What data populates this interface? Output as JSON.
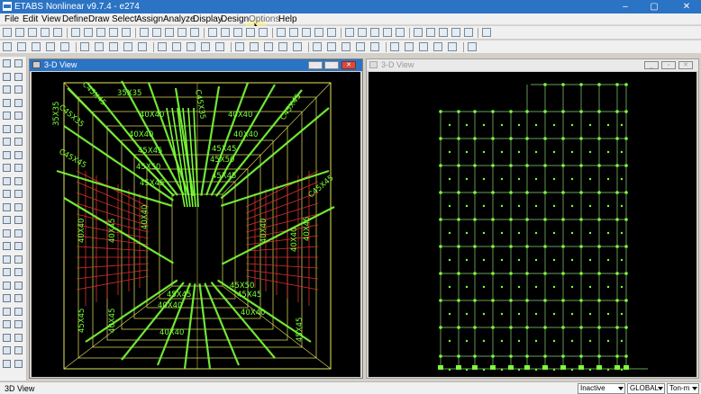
{
  "window": {
    "title": "ETABS Nonlinear v9.7.4 - e274",
    "minimize": "–",
    "maximize": "▢",
    "close": "✕"
  },
  "menu": [
    "File",
    "Edit",
    "View",
    "Define",
    "Draw",
    "Select",
    "Assign",
    "Analyze",
    "Display",
    "Design",
    "Options",
    "Help"
  ],
  "left_view": {
    "title": "3-D View",
    "state": "active",
    "section_labels": {
      "top": "35X35",
      "beam_40": "40X40",
      "beam_45": "45X45",
      "beam_50": "45X50",
      "side_col": "40X40",
      "side_col2": "40X45",
      "lower_40": "40X40",
      "lower_45": "45X45",
      "lower_50": "45X50",
      "col_4045": "40X45",
      "col_4545": "45X45",
      "diag_c": "C45X45",
      "diag_c2": "C45X35",
      "left_col": "35X35"
    }
  },
  "right_view": {
    "title": "3-D View",
    "state": "inactive"
  },
  "status": {
    "view": "3D View",
    "state_dropdown": "Inactive",
    "coord_dropdown": "GLOBAL",
    "units_dropdown": "Ton-m"
  },
  "colors": {
    "model_green": "#7cff3a",
    "frame_yellow": "#e8e860",
    "wall_red": "#d83030",
    "canvas_bg": "#000000"
  }
}
